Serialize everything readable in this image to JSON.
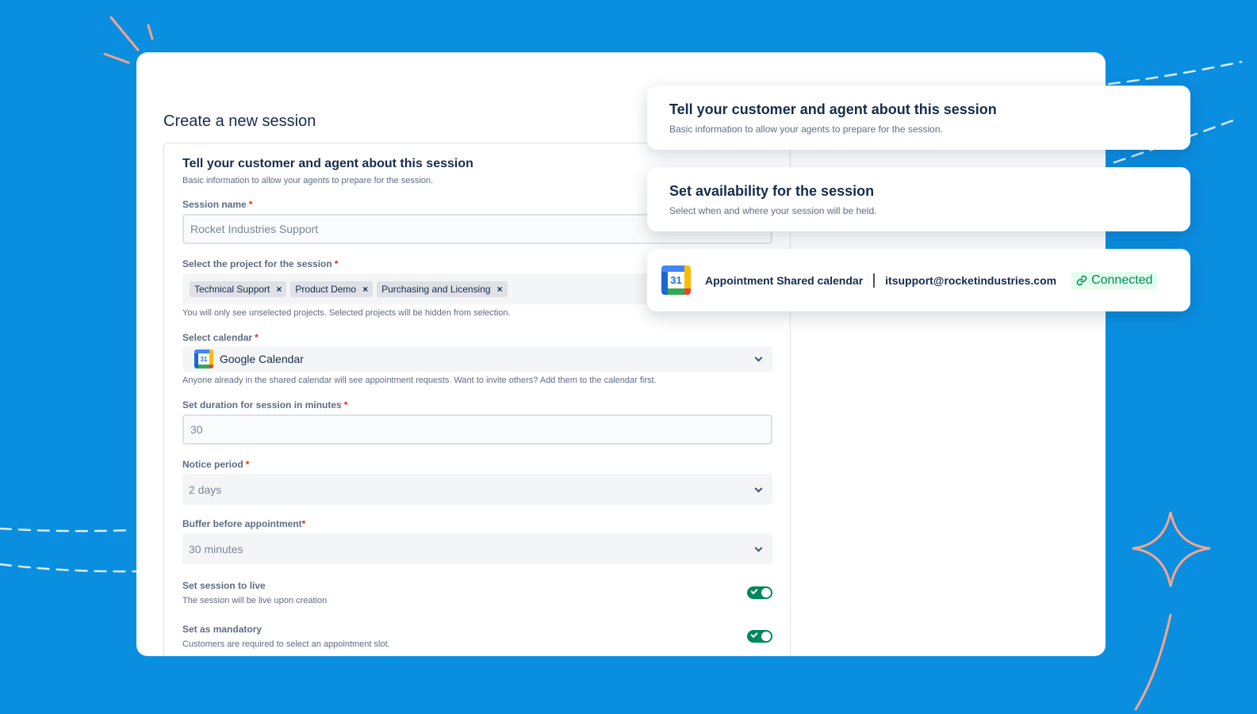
{
  "form": {
    "page_title": "Create a new session",
    "section_title": "Tell your customer and agent about this session",
    "section_desc": "Basic information to allow your agents to prepare for the session.",
    "session_name": {
      "label": "Session name",
      "required": "*",
      "value": "Rocket Industries Support"
    },
    "project": {
      "label": "Select the project for the session",
      "required": "*",
      "tags": [
        "Technical Support",
        "Product Demo",
        "Purchasing and Licensing"
      ],
      "remove_glyph": "×",
      "helper": "You will only see unselected projects. Selected projects will be hidden from selection."
    },
    "calendar": {
      "label": "Select calendar",
      "required": "*",
      "value": "Google Calendar",
      "icon_number": "31",
      "helper": "Anyone already in the shared calendar will see appointment requests. Want to invite others? Add them to the calendar first."
    },
    "duration": {
      "label": "Set duration for session in minutes",
      "required": "*",
      "value": "30"
    },
    "notice": {
      "label": "Notice period",
      "required": "*",
      "value": "2 days"
    },
    "buffer": {
      "label": "Buffer before appointment",
      "required": "*",
      "value": "30 minutes"
    },
    "live": {
      "label": "Set session to live",
      "desc": "The session will be live upon creation",
      "on": true
    },
    "mandatory": {
      "label": "Set as mandatory",
      "desc": "Customers are required to select an appointment slot.",
      "on": true
    }
  },
  "cards": {
    "info": {
      "title": "Tell your customer and agent about this session",
      "desc": "Basic information to allow your agents to prepare for the session."
    },
    "availability": {
      "title": "Set availability for the session",
      "desc": "Select when and where your session will be held."
    },
    "connection": {
      "icon_number": "31",
      "name": "Appointment Shared calendar",
      "email": "itsupport@rocketindustries.com",
      "status": "Connected"
    }
  },
  "colors": {
    "background": "#0a8ee0",
    "decor_accent": "#f4a48c",
    "toggle_on": "#00875a",
    "connected_bg": "#e3fcef",
    "required": "#de350b"
  }
}
